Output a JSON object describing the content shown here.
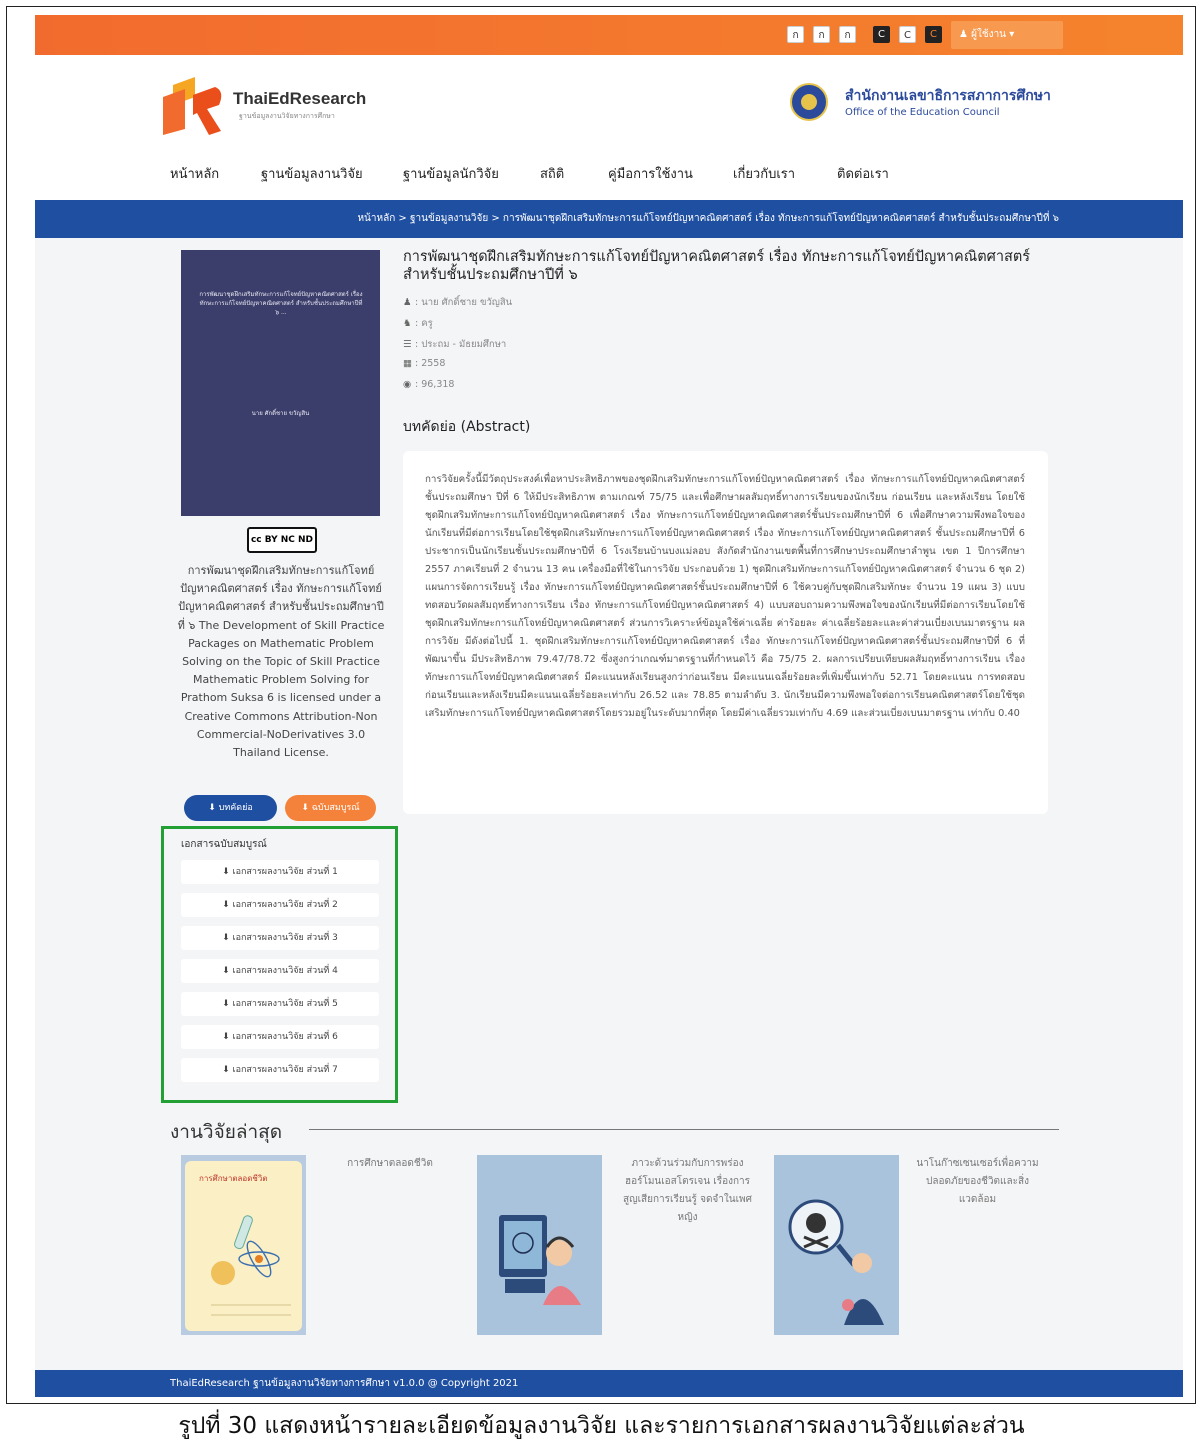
{
  "topbar": {
    "font_buttons": [
      "ก",
      "ก",
      "ก"
    ],
    "contrast_buttons": [
      "C",
      "C",
      "C"
    ],
    "user_label": "ผู้ใช้งาน"
  },
  "header": {
    "logo_name_1": "ThaiEd",
    "logo_name_2": "Research",
    "logo_sub": "ฐานข้อมูลงานวิจัยทางการศึกษา",
    "org_th": "สำนักงานเลขาธิการสภาการศึกษา",
    "org_en": "Office of the Education Council"
  },
  "nav": [
    "หน้าหลัก",
    "ฐานข้อมูลงานวิจัย",
    "ฐานข้อมูลนักวิจัย",
    "สถิติ",
    "คู่มือการใช้งาน",
    "เกี่ยวกับเรา",
    "ติดต่อเรา"
  ],
  "breadcrumb": "หน้าหลัก > ฐานข้อมูลงานวิจัย > การพัฒนาชุดฝึกเสริมทักษะการแก้โจทย์ปัญหาคณิตศาสตร์ เรื่อง ทักษะการแก้โจทย์ปัญหาคณิตศาสตร์ สำหรับชั้นประถมศึกษาปีที่ ๖",
  "cover": {
    "title": "การพัฒนาชุดฝึกเสริมทักษะการแก้โจทย์ปัญหาคณิตศาสตร์ เรื่อง ทักษะการแก้โจทย์ปัญหาคณิตศาสตร์ สำหรับชั้นประถมศึกษาปีที่ ๖ ...",
    "author": "นาย ศักดิ์ชาย ขวัญสิน"
  },
  "cc_badge": "cc BY NC ND",
  "license_text": "การพัฒนาชุดฝึกเสริมทักษะการแก้โจทย์ปัญหาคณิตศาสตร์ เรื่อง ทักษะการแก้โจทย์ปัญหาคณิตศาสตร์ สำหรับชั้นประถมศึกษาปีที่ ๖ The Development of Skill Practice Packages on Mathematic Problem Solving on the Topic of Skill Practice Mathematic Problem Solving for Prathom Suksa 6 is licensed under a Creative Commons Attribution-Non Commercial-NoDerivatives 3.0 Thailand License.",
  "buttons": {
    "abstract": "บทคัดย่อ",
    "fulltext": "ฉบับสมบูรณ์"
  },
  "fulltext_docs": {
    "heading": "เอกสารฉบับสมบูรณ์",
    "items": [
      "เอกสารผลงานวิจัย ส่วนที่ 1",
      "เอกสารผลงานวิจัย ส่วนที่ 2",
      "เอกสารผลงานวิจัย ส่วนที่ 3",
      "เอกสารผลงานวิจัย ส่วนที่ 4",
      "เอกสารผลงานวิจัย ส่วนที่ 5",
      "เอกสารผลงานวิจัย ส่วนที่ 6",
      "เอกสารผลงานวิจัย ส่วนที่ 7"
    ]
  },
  "research": {
    "title": "การพัฒนาชุดฝึกเสริมทักษะการแก้โจทย์ปัญหาคณิตศาสตร์ เรื่อง ทักษะการแก้โจทย์ปัญหาคณิตศาสตร์ สำหรับชั้นประถมศึกษาปีที่ ๖",
    "author": ": นาย ศักดิ์ชาย ขวัญสิน",
    "role": ": ครู",
    "level": ": ประถม - มัธยมศึกษา",
    "year": ": 2558",
    "views": ": 96,318"
  },
  "abstract_heading": "บทคัดย่อ (Abstract)",
  "abstract": "การวิจัยครั้งนี้มีวัตถุประสงค์เพื่อหาประสิทธิภาพของชุดฝึกเสริมทักษะการแก้โจทย์ปัญหาคณิตศาสตร์ เรื่อง ทักษะการแก้โจทย์ปัญหาคณิตศาสตร์ ชั้นประถมศึกษา ปีที่ 6 ให้มีประสิทธิภาพ ตามเกณฑ์ 75/75 และเพื่อศึกษาผลสัมฤทธิ์ทางการเรียนของนักเรียน ก่อนเรียน และหลังเรียน โดยใช้ชุดฝึกเสริมทักษะการแก้โจทย์ปัญหาคณิตศาสตร์ เรื่อง ทักษะการแก้โจทย์ปัญหาคณิตศาสตร์ชั้นประถมศึกษาปีที่ 6 เพื่อศึกษาความพึงพอใจของนักเรียนที่มีต่อการเรียนโดยใช้ชุดฝึกเสริมทักษะการแก้โจทย์ปัญหาคณิตศาสตร์ เรื่อง ทักษะการแก้โจทย์ปัญหาคณิตศาสตร์ ชั้นประถมศึกษาปีที่ 6 ประชากรเป็นนักเรียนชั้นประถมศึกษาปีที่ 6 โรงเรียนบ้านบงแม่ลอบ สังกัดสำนักงานเขตพื้นที่การศึกษาประถมศึกษาลำพูน เขต 1 ปีการศึกษา 2557 ภาคเรียนที่ 2 จำนวน 13 คน เครื่องมือที่ใช้ในการวิจัย ประกอบด้วย 1) ชุดฝึกเสริมทักษะการแก้โจทย์ปัญหาคณิตศาสตร์ จำนวน 6 ชุด 2) แผนการจัดการเรียนรู้ เรื่อง ทักษะการแก้โจทย์ปัญหาคณิตศาสตร์ชั้นประถมศึกษาปีที่ 6 ใช้ควบคู่กับชุดฝึกเสริมทักษะ จำนวน 19 แผน 3) แบบทดสอบวัดผลสัมฤทธิ์ทางการเรียน เรื่อง ทักษะการแก้โจทย์ปัญหาคณิตศาสตร์ 4) แบบสอบถามความพึงพอใจของนักเรียนที่มีต่อการเรียนโดยใช้ชุดฝึกเสริมทักษะการแก้โจทย์ปัญหาคณิตศาสตร์ ส่วนการวิเคราะห์ข้อมูลใช้ค่าเฉลี่ย ค่าร้อยละ ค่าเฉลี่ยร้อยละและค่าส่วนเบี่ยงเบนมาตรฐาน ผลการวิจัย มีดังต่อไปนี้ 1. ชุดฝึกเสริมทักษะการแก้โจทย์ปัญหาคณิตศาสตร์ เรื่อง ทักษะการแก้โจทย์ปัญหาคณิตศาสตร์ชั้นประถมศึกษาปีที่ 6 ที่พัฒนาขึ้น มีประสิทธิภาพ 79.47/78.72 ซึ่งสูงกว่าเกณฑ์มาตรฐานที่กำหนดไว้ คือ 75/75 2. ผลการเปรียบเทียบผลสัมฤทธิ์ทางการเรียน เรื่อง ทักษะการแก้โจทย์ปัญหาคณิตศาสตร์ มีคะแนนหลังเรียนสูงกว่าก่อนเรียน มีคะแนนเฉลี่ยร้อยละที่เพิ่มขึ้นเท่ากับ 52.71 โดยคะแนน การทดสอบก่อนเรียนและหลังเรียนมีคะแนนเฉลี่ยร้อยละเท่ากับ 26.52 และ 78.85 ตามลำดับ 3. นักเรียนมีความพึงพอใจต่อการเรียนคณิตศาสตร์โดยใช้ชุดเสริมทักษะการแก้โจทย์ปัญหาคณิตศาสตร์โดยรวมอยู่ในระดับมากที่สุด โดยมีค่าเฉลี่ยรวมเท่ากับ 4.69 และส่วนเบี่ยงเบนมาตรฐาน เท่ากับ 0.40",
  "latest": {
    "heading": "งานวิจัยล่าสุด",
    "items": [
      {
        "caption": "การศึกษาตลอดชีวิต",
        "cover_label": "การศึกษาตลอดชีวิต"
      },
      {
        "caption": "ภาวะด้วนร่วมกับการพร่องฮอร์โมนเอสโตรเจน เรื่องการสูญเสียการเรียนรู้ จดจำในเพศหญิง"
      },
      {
        "caption": "นาโนก๊าซเซนเซอร์เพื่อความปลอดภัยของชีวิตและสิ่งแวดล้อม"
      }
    ]
  },
  "footer": "ThaiEdResearch ฐานข้อมูลงานวิจัยทางการศึกษา v1.0.0 @ Copyright 2021",
  "figure_caption": "รูปที่ 30 แสดงหน้ารายละเอียดข้อมูลงานวิจัย และรายการเอกสารผลงานวิจัยแต่ละส่วน",
  "colors": {
    "topbar": "#f26b2e",
    "primary": "#1f4fa0",
    "accent": "#f5823a",
    "highlight_box": "#22a033"
  }
}
